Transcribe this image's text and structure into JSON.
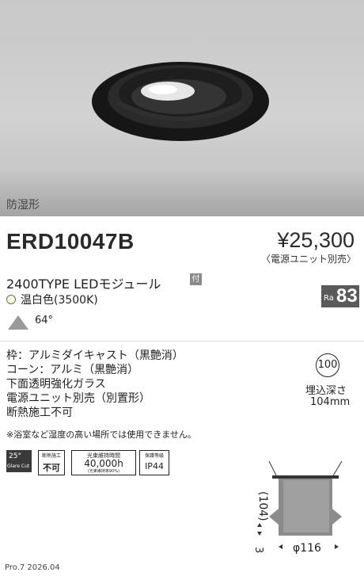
{
  "photo": {
    "label": "防湿形"
  },
  "product": {
    "model": "ERD10047B",
    "price": "¥25,300",
    "price_note": "〈電源ユニット別売〉",
    "type": "2400TYPE LEDモジュール",
    "type_badge": "付",
    "color_temp": "温白色(3500K)",
    "ra_label": "Ra",
    "ra_value": "83",
    "beam_angle": "64°"
  },
  "specs": {
    "frame": "枠：アルミダイキャスト（黒艶消）",
    "cone": "コーン：アルミ（黒艶消）",
    "cover": "下面透明強化ガラス",
    "power": "電源ユニット別売（別置形）",
    "insulation": "断熱施工不可",
    "note": "※浴室など湿度の高い場所では使用できません。"
  },
  "cutout": {
    "size": "100",
    "title": "埋込深さ",
    "depth": "104mm"
  },
  "icons": {
    "glare_deg": "25°",
    "glare_text": "Glare Cut",
    "insulation_head": "断熱施工",
    "insulation_value": "不可",
    "life_head": "光束維持時間",
    "life_value": "40,000h",
    "life_sub": "(光束維持率90%)",
    "ip_head": "保護等級",
    "ip_value": "IP44"
  },
  "diagram": {
    "height": "(104)",
    "offset": "3",
    "diameter": "φ116"
  },
  "footer": {
    "text": "Pro.7 2026.04"
  },
  "colors": {
    "fixture": "#151515",
    "badge": "#5a5a5a"
  }
}
